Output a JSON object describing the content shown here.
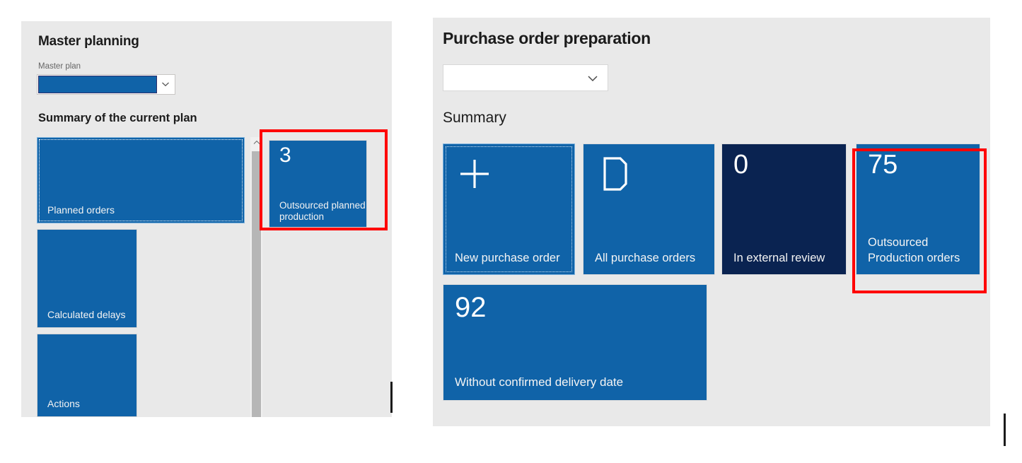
{
  "left_panel": {
    "title": "Master planning",
    "master_plan_label": "Master plan",
    "master_plan_value": "",
    "section_title": "Summary of the current plan",
    "dropdown_icon": "chevron-down-icon",
    "scrollbar_up_icon": "chevron-up-icon",
    "tiles": [
      {
        "count": "",
        "label": "Planned orders",
        "icon": "",
        "focused": true
      },
      {
        "count": "",
        "label": "Calculated delays",
        "icon": "",
        "focused": false
      },
      {
        "count": "",
        "label": "Actions",
        "icon": "",
        "focused": false
      }
    ],
    "highlighted_tile": {
      "count": "3",
      "label": "Outsourced planned production"
    }
  },
  "right_panel": {
    "title": "Purchase order preparation",
    "filter_value": "",
    "filter_icon": "chevron-down-icon",
    "section_title": "Summary",
    "tiles": [
      {
        "count": "",
        "label": "New purchase order",
        "icon": "plus-icon",
        "focused": true,
        "dark": false
      },
      {
        "count": "",
        "label": "All purchase orders",
        "icon": "document-icon",
        "focused": false,
        "dark": false
      },
      {
        "count": "0",
        "label": "In external review",
        "icon": "",
        "focused": false,
        "dark": true
      },
      {
        "count": "75",
        "label": "Outsourced Production orders",
        "icon": "",
        "focused": false,
        "dark": false
      },
      {
        "count": "92",
        "label": "Without confirmed delivery date",
        "icon": "",
        "focused": false,
        "dark": false
      }
    ]
  },
  "annotations": {
    "highlight_color": "#ff0000",
    "left_highlight_target": "Outsourced planned production",
    "right_highlight_target": "Outsourced Production orders"
  },
  "colors": {
    "tile_blue": "#1063a8",
    "tile_navy": "#0a2351",
    "panel_bg": "#e9e9e9",
    "page_bg": "#ffffff"
  }
}
